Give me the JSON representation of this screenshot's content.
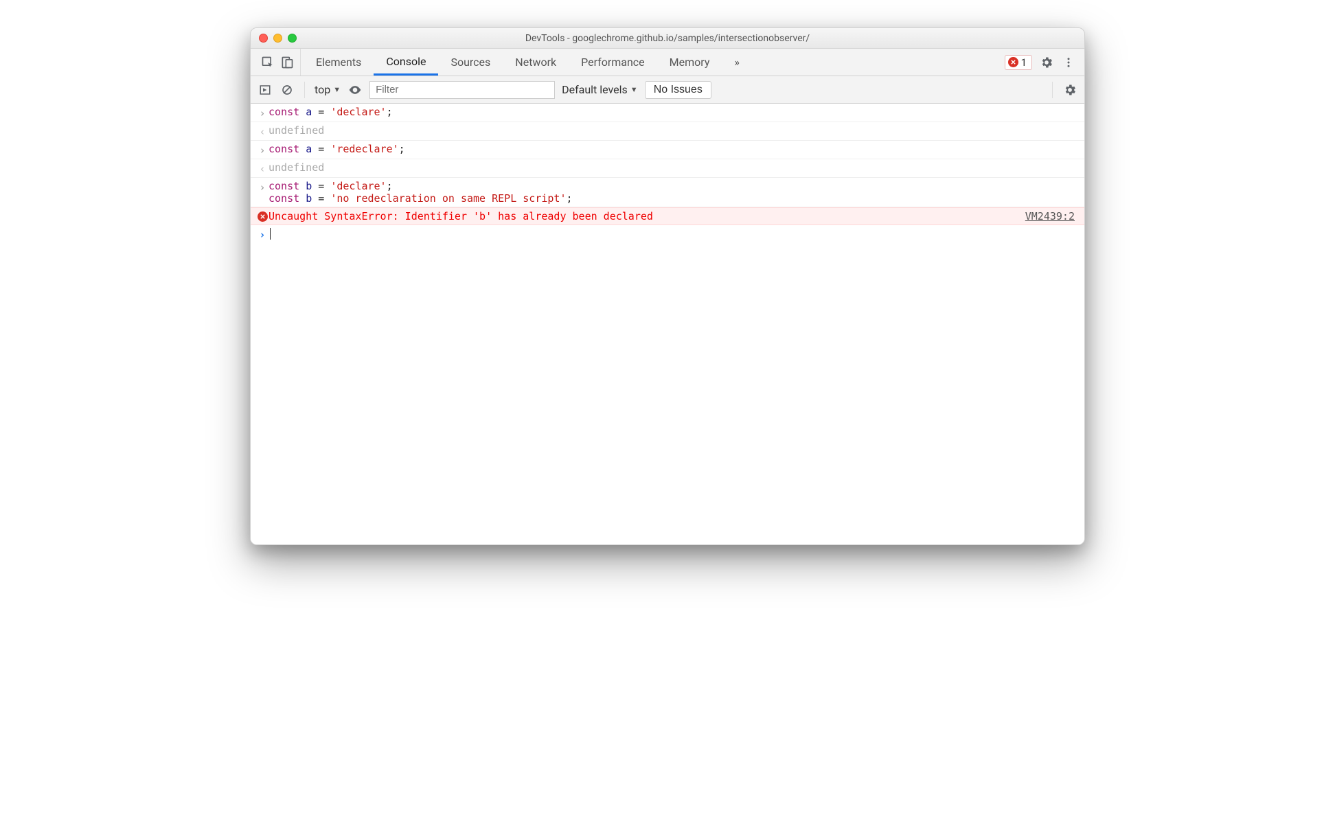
{
  "window": {
    "title": "DevTools - googlechrome.github.io/samples/intersectionobserver/"
  },
  "tabs": {
    "items": [
      "Elements",
      "Console",
      "Sources",
      "Network",
      "Performance",
      "Memory"
    ],
    "active": "Console",
    "overflow": "»",
    "error_count": "1"
  },
  "subbar": {
    "context": "top",
    "filter_placeholder": "Filter",
    "levels_label": "Default levels",
    "issues_label": "No Issues"
  },
  "console": {
    "entries": [
      {
        "type": "input",
        "code": {
          "kw": "const",
          "sp1": " ",
          "var": "a",
          "sp2": " ",
          "op": "=",
          "sp3": " ",
          "str": "'declare'",
          "semi": ";"
        }
      },
      {
        "type": "output",
        "text": "undefined"
      },
      {
        "type": "input",
        "code": {
          "kw": "const",
          "sp1": " ",
          "var": "a",
          "sp2": " ",
          "op": "=",
          "sp3": " ",
          "str": "'redeclare'",
          "semi": ";"
        }
      },
      {
        "type": "output",
        "text": "undefined"
      },
      {
        "type": "input-multiline",
        "lines": [
          {
            "kw": "const",
            "sp1": " ",
            "var": "b",
            "sp2": " ",
            "op": "=",
            "sp3": " ",
            "str": "'declare'",
            "semi": ";"
          },
          {
            "kw": "const",
            "sp1": " ",
            "var": "b",
            "sp2": " ",
            "op": "=",
            "sp3": " ",
            "str": "'no redeclaration on same REPL script'",
            "semi": ";"
          }
        ]
      },
      {
        "type": "error",
        "text": "Uncaught SyntaxError: Identifier 'b' has already been declared",
        "link": "VM2439:2"
      },
      {
        "type": "prompt"
      }
    ]
  }
}
